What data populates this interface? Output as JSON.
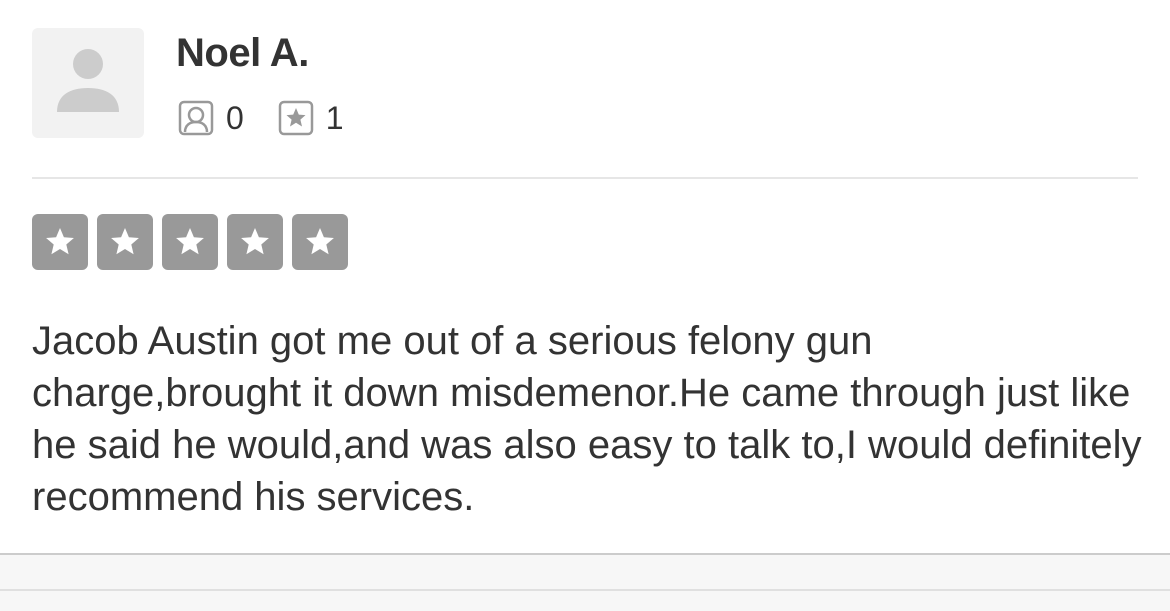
{
  "review": {
    "user": {
      "name": "Noel A.",
      "avatar_icon": "default-user-avatar-icon",
      "stats": {
        "friends_icon": "friends-icon",
        "friends_count": "0",
        "reviews_icon": "review-star-icon",
        "reviews_count": "1"
      }
    },
    "rating": {
      "stars": 5,
      "max": 5,
      "star_color": "#999999"
    },
    "text": "Jacob Austin got me out of a serious felony gun charge,brought it down misdemenor.He came through just like he said he would,and was also easy to talk to,I would definitely recommend his services."
  },
  "colors": {
    "text": "#333333",
    "icon": "#999999",
    "avatar_bg": "#f2f2f2",
    "avatar_fg": "#cccccc",
    "divider": "#e6e6e6"
  }
}
